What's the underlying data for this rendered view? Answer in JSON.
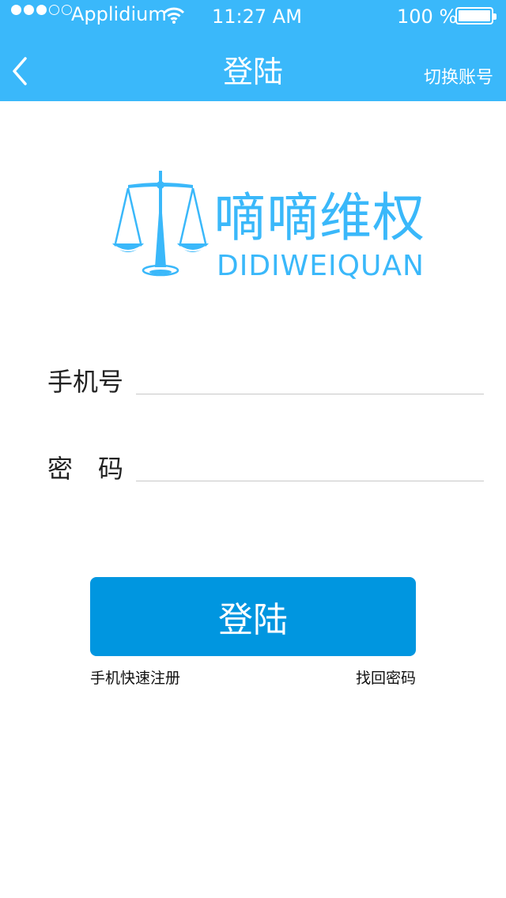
{
  "status_bar": {
    "carrier": "Applidium",
    "time": "11:27 AM",
    "battery": "100 %",
    "signal_bars_filled": 3,
    "signal_bars_total": 5
  },
  "nav": {
    "title": "登陆",
    "right_label": "切换账号",
    "back_icon": "chevron-left-icon"
  },
  "logo": {
    "cn": "嘀嘀维权",
    "en": "DIDIWEIQUAN",
    "icon": "scales-icon"
  },
  "form": {
    "phone_label": "手机号",
    "phone_value": "",
    "password_label": "密　码",
    "password_value": ""
  },
  "actions": {
    "login_label": "登陆",
    "register_label": "手机快速注册",
    "forgot_label": "找回密码"
  },
  "colors": {
    "header": "#3ab8fa",
    "button": "#0096e0",
    "logo": "#3ab8fa"
  }
}
